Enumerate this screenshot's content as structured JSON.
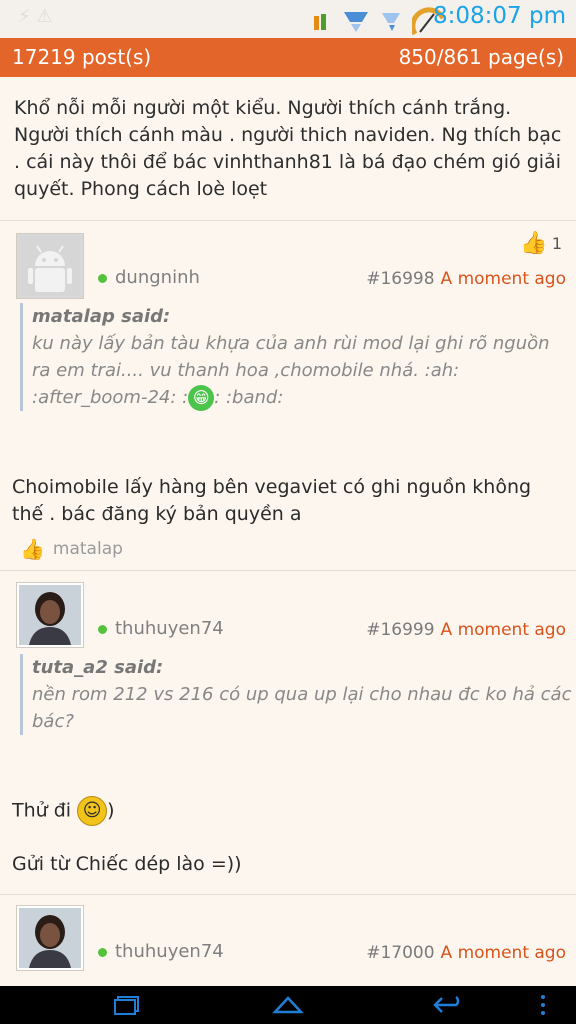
{
  "status": {
    "time": "8:08:07 pm"
  },
  "header": {
    "posts": "17219 post(s)",
    "pages": "850/861 page(s)"
  },
  "prev_post": {
    "text": "Khổ nỗi mỗi người một kiểu. Người thích cánh trắng. Người thích cánh màu . người thich naviden. Ng thích bạc . cái này thôi để bác vinhthanh81 là bá đạo chém gió giải quyết. Phong cách loè loẹt"
  },
  "posts": [
    {
      "username": "dungninh",
      "number": "#16998",
      "time": "A moment ago",
      "likes": "1",
      "quote_author": "matalap said:",
      "quote_text": "ku này lấy bản tàu khựa của anh rùi mod lại ghi rõ nguồn ra em trai.... vu thanh hoa ,chomobile nhá. :ah: :after_boom-24: :",
      "quote_tail": ": :band:",
      "body": "Choimobile lấy hàng bên vegaviet có ghi nguồn không thế . bác đăng ký bản quyền a",
      "liked_by": "matalap"
    },
    {
      "username": "thuhuyen74",
      "number": "#16999",
      "time": "A moment ago",
      "quote_author": "tuta_a2 said:",
      "quote_text": "nền rom 212 vs 216 có up qua up lại cho nhau đc ko hả các bác?",
      "body_line1": "Thử đi",
      "body_line1_tail": ")",
      "body_line2": "Gửi từ Chiếc dép lào =))"
    },
    {
      "username": "thuhuyen74",
      "number": "#17000",
      "time": "A moment ago"
    }
  ],
  "colors": {
    "accent": "#e4652a",
    "time_blue": "#1aa3e6",
    "online": "#54c23a",
    "nav_icon": "#1f7fd6"
  }
}
